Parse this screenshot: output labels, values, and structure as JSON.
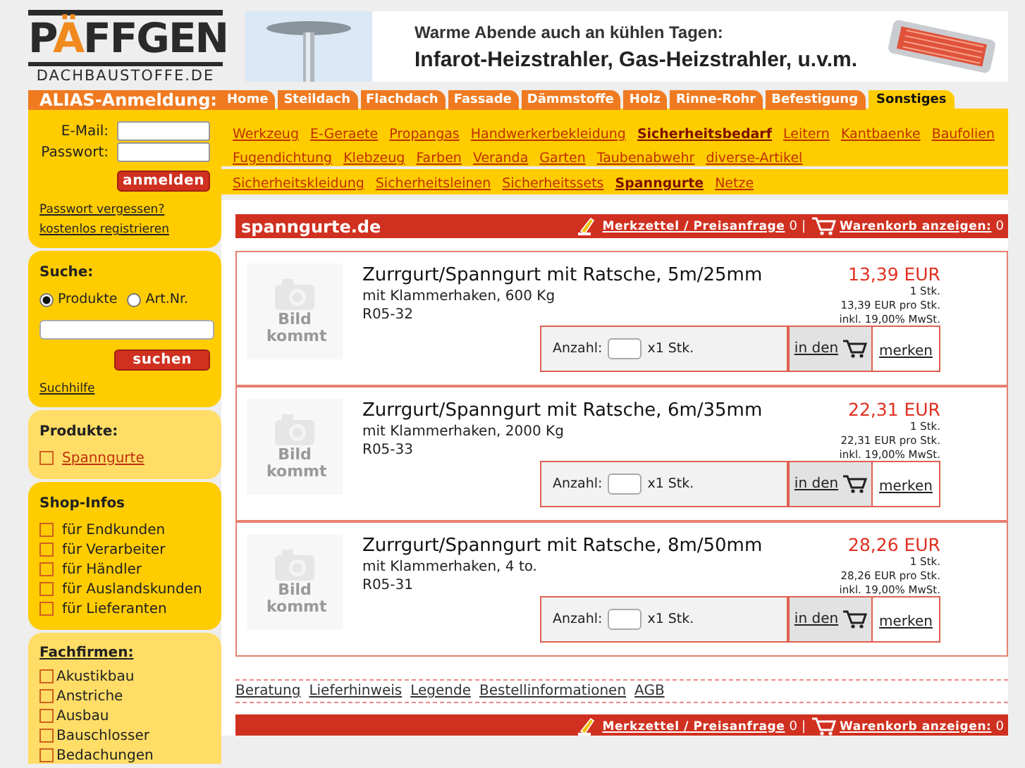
{
  "logo": {
    "parts": [
      {
        "text": "P",
        "accent": false
      },
      {
        "text": "Ä",
        "accent": true
      },
      {
        "text": "FFGEN",
        "accent": false
      }
    ],
    "domain": "DACHBAUSTOFFE.DE"
  },
  "banner": {
    "line1": "Warme Abende auch an kühlen Tagen:",
    "line2": "Infarot-Heizstrahler, Gas-Heizstrahler, u.v.m."
  },
  "login": {
    "title": "ALIAS-Anmeldung:",
    "email_label": "E-Mail:",
    "password_label": "Passwort:",
    "button": "anmelden",
    "links": [
      "Passwort vergessen?",
      "kostenlos registrieren"
    ]
  },
  "search": {
    "title": "Suche:",
    "options": [
      {
        "label": "Produkte",
        "selected": true
      },
      {
        "label": "Art.Nr.",
        "selected": false
      }
    ],
    "button": "suchen",
    "help": "Suchhilfe"
  },
  "products_box": {
    "title": "Produkte:",
    "items": [
      "Spanngurte"
    ]
  },
  "shop_infos": {
    "title": "Shop-Infos",
    "items": [
      "für Endkunden",
      "für Verarbeiter",
      "für Händler",
      "für Auslandskunden",
      "für Lieferanten"
    ]
  },
  "fachfirmen": {
    "title": "Fachfirmen:",
    "items": [
      "Akustikbau",
      "Anstriche",
      "Ausbau",
      "Bauschlosser",
      "Bedachungen"
    ]
  },
  "tabs": [
    {
      "label": "Home",
      "selected": false
    },
    {
      "label": "Steildach",
      "selected": false
    },
    {
      "label": "Flachdach",
      "selected": false
    },
    {
      "label": "Fassade",
      "selected": false
    },
    {
      "label": "Dämmstoffe",
      "selected": false
    },
    {
      "label": "Holz",
      "selected": false
    },
    {
      "label": "Rinne-Rohr",
      "selected": false
    },
    {
      "label": "Befestigung",
      "selected": false
    },
    {
      "label": "Sonstiges",
      "selected": true
    }
  ],
  "categories": [
    {
      "label": "Werkzeug",
      "selected": false
    },
    {
      "label": "E-Geraete",
      "selected": false
    },
    {
      "label": "Propangas",
      "selected": false
    },
    {
      "label": "Handwerkerbekleidung",
      "selected": false
    },
    {
      "label": "Sicherheitsbedarf",
      "selected": true
    },
    {
      "label": "Leitern",
      "selected": false
    },
    {
      "label": "Kantbaenke",
      "selected": false
    },
    {
      "label": "Baufolien",
      "selected": false
    },
    {
      "label": "Fugendichtung",
      "selected": false
    },
    {
      "label": "Klebzeug",
      "selected": false
    },
    {
      "label": "Farben",
      "selected": false
    },
    {
      "label": "Veranda",
      "selected": false
    },
    {
      "label": "Garten",
      "selected": false
    },
    {
      "label": "Taubenabwehr",
      "selected": false
    },
    {
      "label": "diverse-Artikel",
      "selected": false
    }
  ],
  "subcategories": [
    {
      "label": "Sicherheitskleidung",
      "selected": false
    },
    {
      "label": "Sicherheitsleinen",
      "selected": false
    },
    {
      "label": "Sicherheitssets",
      "selected": false
    },
    {
      "label": "Spanngurte",
      "selected": true
    },
    {
      "label": "Netze",
      "selected": false
    }
  ],
  "shop_bar": {
    "title": "spanngurte.de",
    "wishlist_label": "Merkzettel / Preisanfrage",
    "wishlist_count": "0",
    "separator": "|",
    "cart_label": "Warenkorb anzeigen:",
    "cart_count": "0"
  },
  "products": [
    {
      "image_label": "Bild kommt",
      "name": "Zurrgurt/Spanngurt mit Ratsche, 5m/25mm",
      "description": "mit Klammerhaken, 600 Kg",
      "article_no": "R05-32",
      "price": "13,39 EUR",
      "quantity": "1 Stk.",
      "unit_price": "13,39 EUR pro Stk.",
      "tax_note": "inkl. 19,00% MwSt.",
      "amount_label": "Anzahl:",
      "amount_unit": "x1 Stk.",
      "cart_button": "in den",
      "remember_button": "merken"
    },
    {
      "image_label": "Bild kommt",
      "name": "Zurrgurt/Spanngurt mit Ratsche, 6m/35mm",
      "description": "mit Klammerhaken, 2000 Kg",
      "article_no": "R05-33",
      "price": "22,31 EUR",
      "quantity": "1 Stk.",
      "unit_price": "22,31 EUR pro Stk.",
      "tax_note": "inkl. 19,00% MwSt.",
      "amount_label": "Anzahl:",
      "amount_unit": "x1 Stk.",
      "cart_button": "in den",
      "remember_button": "merken"
    },
    {
      "image_label": "Bild kommt",
      "name": "Zurrgurt/Spanngurt mit Ratsche, 8m/50mm",
      "description": "mit Klammerhaken, 4 to.",
      "article_no": "R05-31",
      "price": "28,26 EUR",
      "quantity": "1 Stk.",
      "unit_price": "28,26 EUR pro Stk.",
      "tax_note": "inkl. 19,00% MwSt.",
      "amount_label": "Anzahl:",
      "amount_unit": "x1 Stk.",
      "cart_button": "in den",
      "remember_button": "merken"
    }
  ],
  "footer_links": [
    "Beratung",
    "Lieferhinweis",
    "Legende",
    "Bestellinformationen",
    "AGB"
  ],
  "bottom_bar": {
    "wishlist_label": "Merkzettel / Preisanfrage",
    "wishlist_count": "0",
    "separator": "|",
    "cart_label": "Warenkorb anzeigen:",
    "cart_count": "0"
  }
}
